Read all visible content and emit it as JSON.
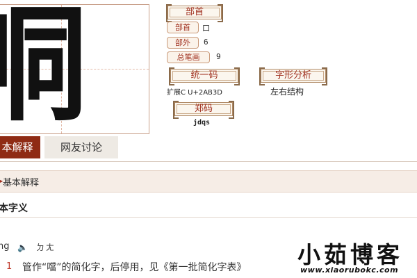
{
  "character": {
    "glyph": "哃"
  },
  "radical_panel": {
    "title": "部首",
    "rows": [
      {
        "label": "部首",
        "value": "口"
      },
      {
        "label": "部外",
        "value": "6"
      },
      {
        "label": "总笔画",
        "value": "9"
      }
    ]
  },
  "unicode_panel": {
    "title": "统一码",
    "value": "扩展C U+2AB3D"
  },
  "structure_panel": {
    "title": "字形分析",
    "value": "左右结构"
  },
  "zhengma_panel": {
    "title": "郑码",
    "value": "jdqs"
  },
  "tabs": [
    {
      "label": "本解释",
      "active": true
    },
    {
      "label": "网友讨论",
      "active": false
    }
  ],
  "section": {
    "title": "基本解释",
    "subheading": "本字义",
    "pinyin": "ng",
    "zhuyin": "ㄉㄤ",
    "definitions": [
      {
        "num": "1",
        "text": "管作“噹”的简化字，后停用，见《第一批简化字表》"
      }
    ]
  },
  "watermark": {
    "title": "小茹博客",
    "url": "www.xiaorubokc.com"
  },
  "colors": {
    "accent": "#a0301f",
    "active_tab": "#8f2b14",
    "section_bg": "#f6ede6"
  }
}
